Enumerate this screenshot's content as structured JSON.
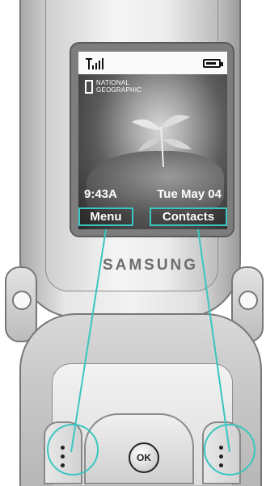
{
  "status": {
    "signal_icon": "signal-strength-icon",
    "battery_icon": "battery-icon"
  },
  "wallpaper": {
    "logo_lines": [
      "NATIONAL",
      "GEOGRAPHIC"
    ]
  },
  "clock": {
    "time": "9:43A",
    "date": "Tue May 04"
  },
  "softkeys": {
    "left": "Menu",
    "right": "Contacts"
  },
  "brand": "SAMSUNG",
  "keys": {
    "ok_label": "OK"
  },
  "colors": {
    "highlight": "#39c6c0"
  }
}
